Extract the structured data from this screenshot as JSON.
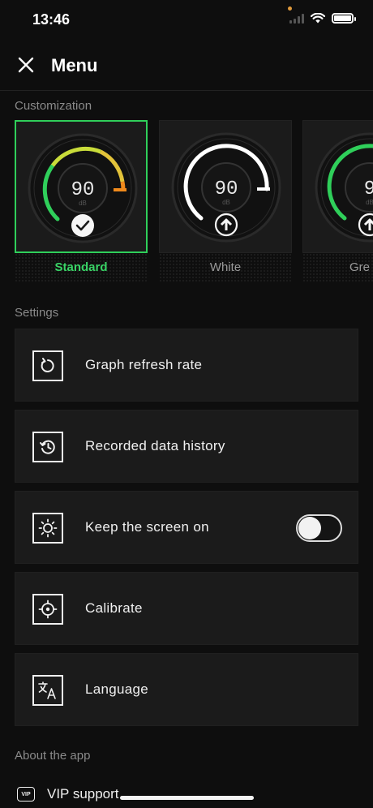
{
  "status_bar": {
    "time": "13:46"
  },
  "header": {
    "title": "Menu",
    "close_icon": "close-icon"
  },
  "customization": {
    "section_title": "Customization",
    "themes": [
      {
        "label": "Standard",
        "value": "90",
        "unit": "dB",
        "state": "selected",
        "badge_icon": "checkmark-icon",
        "colors": [
          "#2fcf5a",
          "#e3d13a",
          "#f08a1c"
        ]
      },
      {
        "label": "White",
        "value": "90",
        "unit": "dB",
        "state": "locked",
        "badge_icon": "arrow-up-icon",
        "colors": [
          "#ffffff"
        ]
      },
      {
        "label": "Gre",
        "value": "9",
        "unit": "dB",
        "state": "locked",
        "badge_icon": "arrow-up-icon",
        "colors": [
          "#2fcf5a"
        ]
      }
    ]
  },
  "settings": {
    "section_title": "Settings",
    "items": [
      {
        "label": "Graph refresh rate",
        "icon": "refresh-icon"
      },
      {
        "label": "Recorded data history",
        "icon": "history-icon"
      },
      {
        "label": "Keep the screen on",
        "icon": "brightness-icon",
        "toggle": false
      },
      {
        "label": "Calibrate",
        "icon": "crosshair-icon"
      },
      {
        "label": "Language",
        "icon": "translate-icon"
      }
    ]
  },
  "about": {
    "section_title": "About the app",
    "vip_badge": "VIP",
    "vip_label": "VIP support"
  }
}
